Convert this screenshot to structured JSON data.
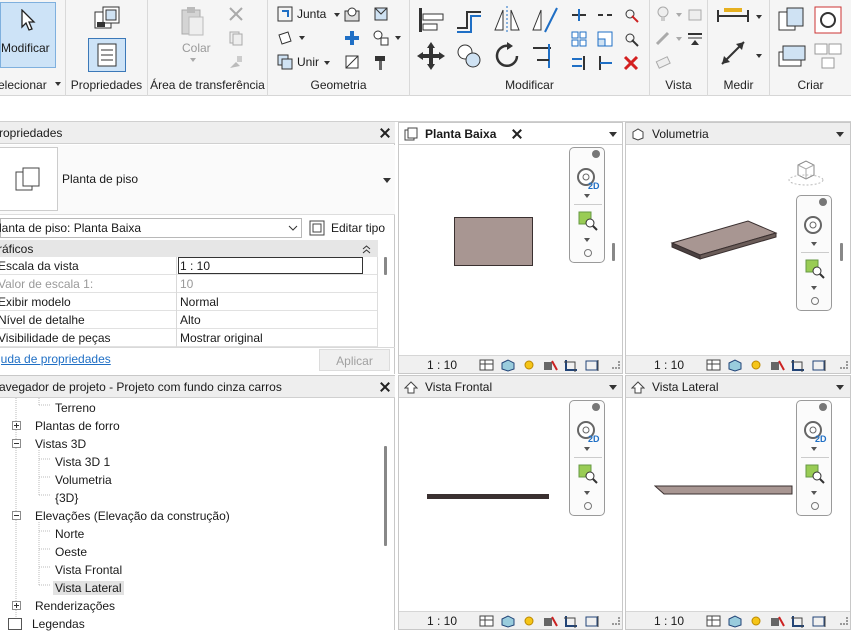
{
  "ribbon": {
    "modify_label": "Modificar",
    "select_label": "elecionar",
    "properties_label": "Propriedades",
    "clipboard_label": "Área de transferência",
    "paste_label": "Colar",
    "geometry_label": "Geometria",
    "join_label": "Junta",
    "unite_label": "Unir",
    "modify_panel_label": "Modificar",
    "view_label": "Vista",
    "measure_label": "Medir",
    "create_label": "Criar"
  },
  "properties": {
    "title": "ropriedades",
    "type_name": "Planta de piso",
    "instance_selector": "lanta de piso: Planta Baixa",
    "edit_type": "Editar tipo",
    "group": "ráficos",
    "rows": [
      {
        "key": "Escala da vista",
        "value": "1 : 10"
      },
      {
        "key": "Valor de escala    1:",
        "value": "10"
      },
      {
        "key": "Exibir modelo",
        "value": "Normal"
      },
      {
        "key": "Nível de detalhe",
        "value": "Alto"
      },
      {
        "key": "Visibilidade de peças",
        "value": "Mostrar original"
      }
    ],
    "help_link": "juda de propriedades",
    "apply_button": "Aplicar"
  },
  "browser": {
    "title": "avegador de projeto - Projeto com fundo cinza carros",
    "items": [
      "Terreno",
      "Plantas de forro",
      "Vistas 3D",
      "Vista 3D 1",
      "Volumetria",
      "{3D}",
      "Elevações (Elevação da construção)",
      "Norte",
      "Oeste",
      "Vista Frontal",
      "Vista Lateral",
      "Renderizações",
      "Legendas"
    ]
  },
  "views": {
    "plan": {
      "title": "Planta Baixa",
      "scale": "1 : 10"
    },
    "volumetry": {
      "title": "Volumetria",
      "scale": "1 : 10"
    },
    "front": {
      "title": "Vista Frontal",
      "scale": "1 : 10"
    },
    "side": {
      "title": "Vista Lateral",
      "scale": "1 : 10"
    },
    "navbar_badge": "2D"
  },
  "colors": {
    "accent": "#1f6fc5",
    "slab": "#a89692",
    "slab_dark": "#3a3030"
  }
}
